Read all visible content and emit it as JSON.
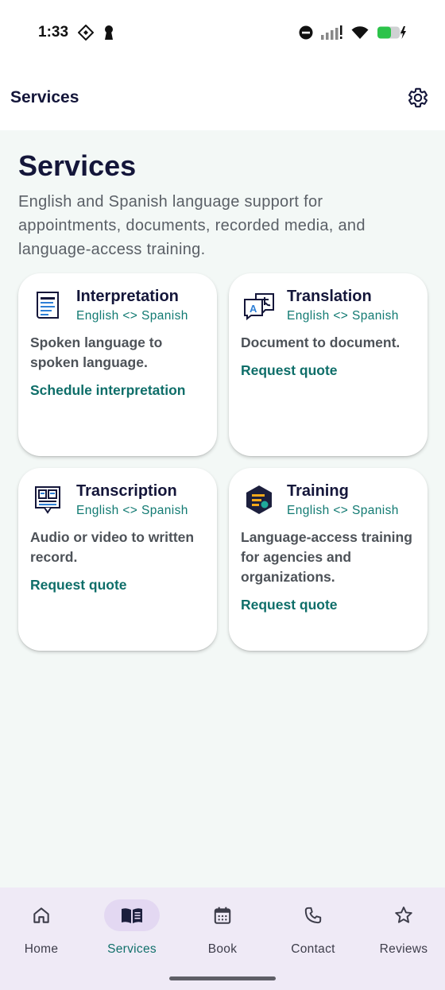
{
  "status_bar": {
    "time": "1:33",
    "icons": [
      "diamond-nav-icon",
      "keyhole-icon",
      "do-not-disturb-icon",
      "signal-icon",
      "wifi-icon",
      "battery-charging-icon"
    ]
  },
  "app_bar": {
    "title": "Services",
    "settings_icon": "gear-icon"
  },
  "page": {
    "title": "Services",
    "subtitle": "English and Spanish language support for appointments, documents, recorded media, and language-access training."
  },
  "services": [
    {
      "title": "Interpretation",
      "languages": "English <> Spanish",
      "description": "Spoken language to spoken language.",
      "action": "Schedule interpretation",
      "icon": "document-lines-icon"
    },
    {
      "title": "Translation",
      "languages": "English <> Spanish",
      "description": "Document to document.",
      "action": "Request quote",
      "icon": "translate-bubbles-icon"
    },
    {
      "title": "Transcription",
      "languages": "English <> Spanish",
      "description": "Audio or video to written record.",
      "action": "Request quote",
      "icon": "transcript-screen-icon"
    },
    {
      "title": "Training",
      "languages": "English <> Spanish",
      "description": "Language-access training for agencies and organizations.",
      "action": "Request quote",
      "icon": "training-hexagon-icon"
    }
  ],
  "colors": {
    "accent": "#11706b",
    "title": "#14163a",
    "background": "#f3f8f6",
    "nav_background": "#efeaf6",
    "nav_active_pill": "#e3d8f2"
  },
  "bottom_nav": {
    "active": "Services",
    "items": [
      {
        "label": "Home",
        "icon": "home-icon"
      },
      {
        "label": "Services",
        "icon": "book-open-icon"
      },
      {
        "label": "Book",
        "icon": "calendar-icon"
      },
      {
        "label": "Contact",
        "icon": "phone-icon"
      },
      {
        "label": "Reviews",
        "icon": "star-icon"
      }
    ]
  }
}
